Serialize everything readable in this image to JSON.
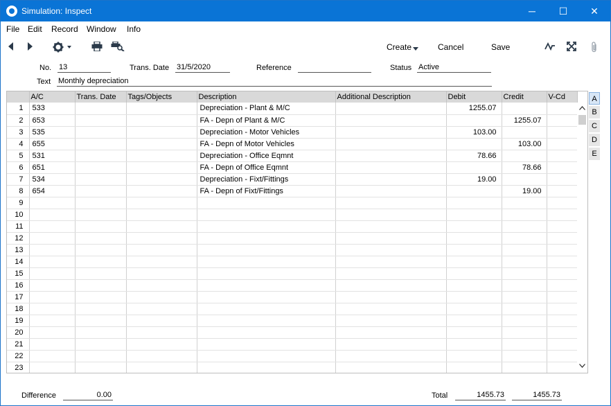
{
  "window": {
    "title": "Simulation: Inspect",
    "minimize": "─",
    "maximize": "☐",
    "close": "✕"
  },
  "menu": {
    "items": [
      "File",
      "Edit",
      "Record",
      "Window",
      "Info"
    ]
  },
  "toolbar": {
    "create_label": "Create",
    "cancel_label": "Cancel",
    "save_label": "Save"
  },
  "header": {
    "no_label": "No.",
    "no_value": "13",
    "trans_date_label": "Trans. Date",
    "trans_date_value": "31/5/2020",
    "reference_label": "Reference",
    "reference_value": "",
    "status_label": "Status",
    "status_value": "Active",
    "text_label": "Text",
    "text_value": "Monthly depreciation"
  },
  "grid": {
    "columns": [
      "",
      "A/C",
      "Trans. Date",
      "Tags/Objects",
      "Description",
      "Additional Description",
      "Debit",
      "Credit",
      "V-Cd"
    ],
    "rows": [
      {
        "n": "1",
        "ac": "533",
        "td": "",
        "tags": "",
        "desc": "Depreciation - Plant & M/C",
        "adesc": "",
        "debit": "1255.07",
        "credit": "",
        "vcd": ""
      },
      {
        "n": "2",
        "ac": "653",
        "td": "",
        "tags": "",
        "desc": "FA - Depn of Plant & M/C",
        "adesc": "",
        "debit": "",
        "credit": "1255.07",
        "vcd": ""
      },
      {
        "n": "3",
        "ac": "535",
        "td": "",
        "tags": "",
        "desc": "Depreciation - Motor Vehicles",
        "adesc": "",
        "debit": "103.00",
        "credit": "",
        "vcd": ""
      },
      {
        "n": "4",
        "ac": "655",
        "td": "",
        "tags": "",
        "desc": "FA - Depn of Motor Vehicles",
        "adesc": "",
        "debit": "",
        "credit": "103.00",
        "vcd": ""
      },
      {
        "n": "5",
        "ac": "531",
        "td": "",
        "tags": "",
        "desc": "Depreciation - Office Eqmnt",
        "adesc": "",
        "debit": "78.66",
        "credit": "",
        "vcd": ""
      },
      {
        "n": "6",
        "ac": "651",
        "td": "",
        "tags": "",
        "desc": "FA - Depn of Office Eqmnt",
        "adesc": "",
        "debit": "",
        "credit": "78.66",
        "vcd": ""
      },
      {
        "n": "7",
        "ac": "534",
        "td": "",
        "tags": "",
        "desc": "Depreciation - Fixt/Fittings",
        "adesc": "",
        "debit": "19.00",
        "credit": "",
        "vcd": ""
      },
      {
        "n": "8",
        "ac": "654",
        "td": "",
        "tags": "",
        "desc": "FA - Depn of Fixt/Fittings",
        "adesc": "",
        "debit": "",
        "credit": "19.00",
        "vcd": ""
      },
      {
        "n": "9"
      },
      {
        "n": "10"
      },
      {
        "n": "11"
      },
      {
        "n": "12"
      },
      {
        "n": "13"
      },
      {
        "n": "14"
      },
      {
        "n": "15"
      },
      {
        "n": "16"
      },
      {
        "n": "17"
      },
      {
        "n": "18"
      },
      {
        "n": "19"
      },
      {
        "n": "20"
      },
      {
        "n": "21"
      },
      {
        "n": "22"
      },
      {
        "n": "23"
      }
    ]
  },
  "tabs": [
    "A",
    "B",
    "C",
    "D",
    "E"
  ],
  "footer": {
    "difference_label": "Difference",
    "difference_value": "0.00",
    "total_label": "Total",
    "total_debit": "1455.73",
    "total_credit": "1455.73"
  },
  "colors": {
    "titlebar": "#0a74d6",
    "grid_header": "#d9d9d9"
  },
  "icons": [
    "back-arrow-icon",
    "forward-arrow-icon",
    "gear-icon",
    "print-icon",
    "print-preview-icon",
    "activity-icon",
    "expand-icon",
    "paperclip-icon"
  ]
}
